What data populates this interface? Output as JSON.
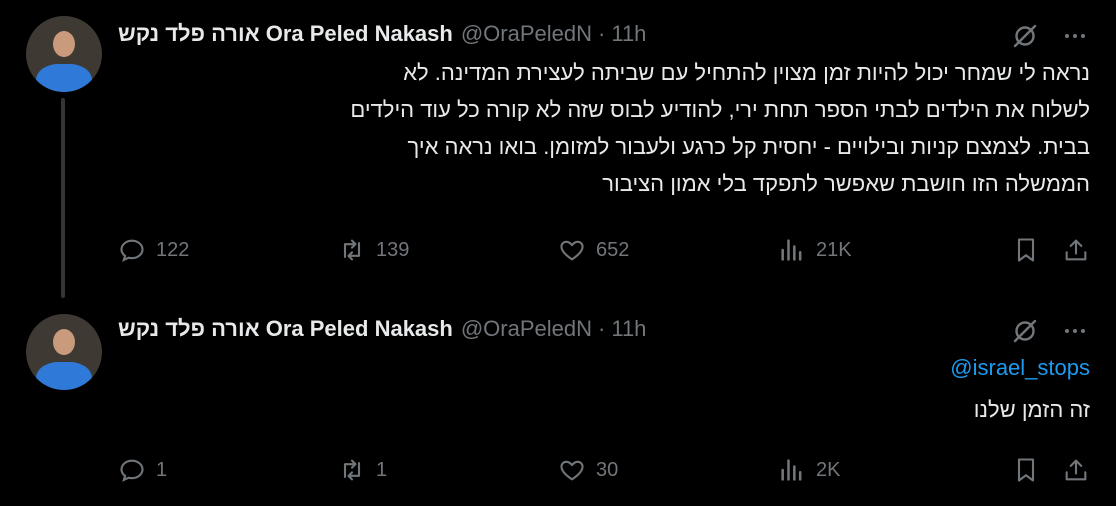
{
  "tweets": [
    {
      "author": {
        "display_name": "אורה פלד נקש Ora Peled Nakash",
        "handle": "@OraPeledN"
      },
      "dot": "·",
      "time": "11h",
      "mention": "",
      "text": "נראה לי שמחר יכול להיות זמן מצוין להתחיל עם שביתה לעצירת המדינה. לא\nלשלוח את הילדים לבתי הספר תחת ירי, להודיע לבוס שזה לא קורה כל עוד הילדים\nבבית. לצמצם קניות ובילויים - יחסית קל כרגע ולעבור למזומן. בואו נראה איך\nהממשלה הזו חושבת שאפשר לתפקד בלי אמון הציבור",
      "stats": {
        "replies": "122",
        "reposts": "139",
        "likes": "652",
        "views": "21K"
      }
    },
    {
      "author": {
        "display_name": "אורה פלד נקש Ora Peled Nakash",
        "handle": "@OraPeledN"
      },
      "dot": "·",
      "time": "11h",
      "mention": "@israel_stops",
      "text": "זה הזמן שלנו",
      "stats": {
        "replies": "1",
        "reposts": "1",
        "likes": "30",
        "views": "2K"
      }
    }
  ],
  "icons": {
    "reply": "reply-icon",
    "repost": "repost-icon",
    "like": "heart-icon",
    "views": "views-icon",
    "bookmark": "bookmark-icon",
    "share": "share-icon",
    "grok": "grok-icon",
    "more": "more-icon"
  },
  "colors": {
    "background": "#000000",
    "text": "#e7e9ea",
    "secondary": "#71767b",
    "link": "#1d9bf0",
    "thread_line": "#333639"
  }
}
